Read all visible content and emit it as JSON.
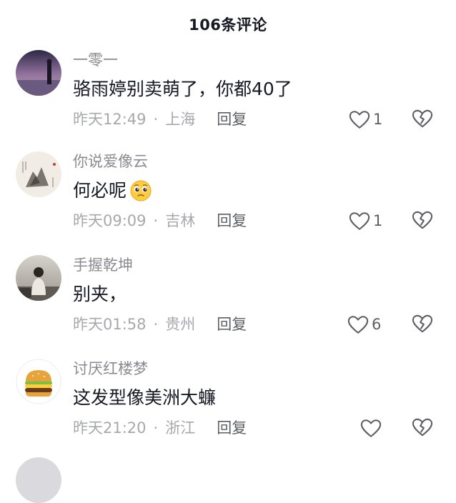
{
  "header": {
    "title": "106条评论"
  },
  "comments": [
    {
      "user": "一零一",
      "text": "骆雨婷别卖萌了，你都40了",
      "time": "昨天12:49",
      "location": "上海",
      "reply": "回复",
      "likes": "1",
      "avatar": "sunset-figure-avatar"
    },
    {
      "user": "你说爱像云",
      "text": "何必呢",
      "emoji": "pleading-face-emoji",
      "time": "昨天09:09",
      "location": "吉林",
      "reply": "回复",
      "likes": "1",
      "avatar": "ink-painting-avatar"
    },
    {
      "user": "手握乾坤",
      "text": "别夹，",
      "time": "昨天01:58",
      "location": "贵州",
      "reply": "回复",
      "likes": "6",
      "avatar": "person-sitting-avatar"
    },
    {
      "user": "讨厌红楼梦",
      "text": "这发型像美洲大蠊",
      "time": "昨天21:20",
      "location": "浙江",
      "reply": "回复",
      "likes": "",
      "avatar": "hamburger-avatar"
    }
  ],
  "icons": {
    "like": "heart-outline-icon",
    "dislike": "broken-heart-icon"
  },
  "colors": {
    "text": "#161823",
    "secondary": "#8a8b91",
    "meta": "#a7a8ad",
    "icon": "#5d5e66"
  }
}
